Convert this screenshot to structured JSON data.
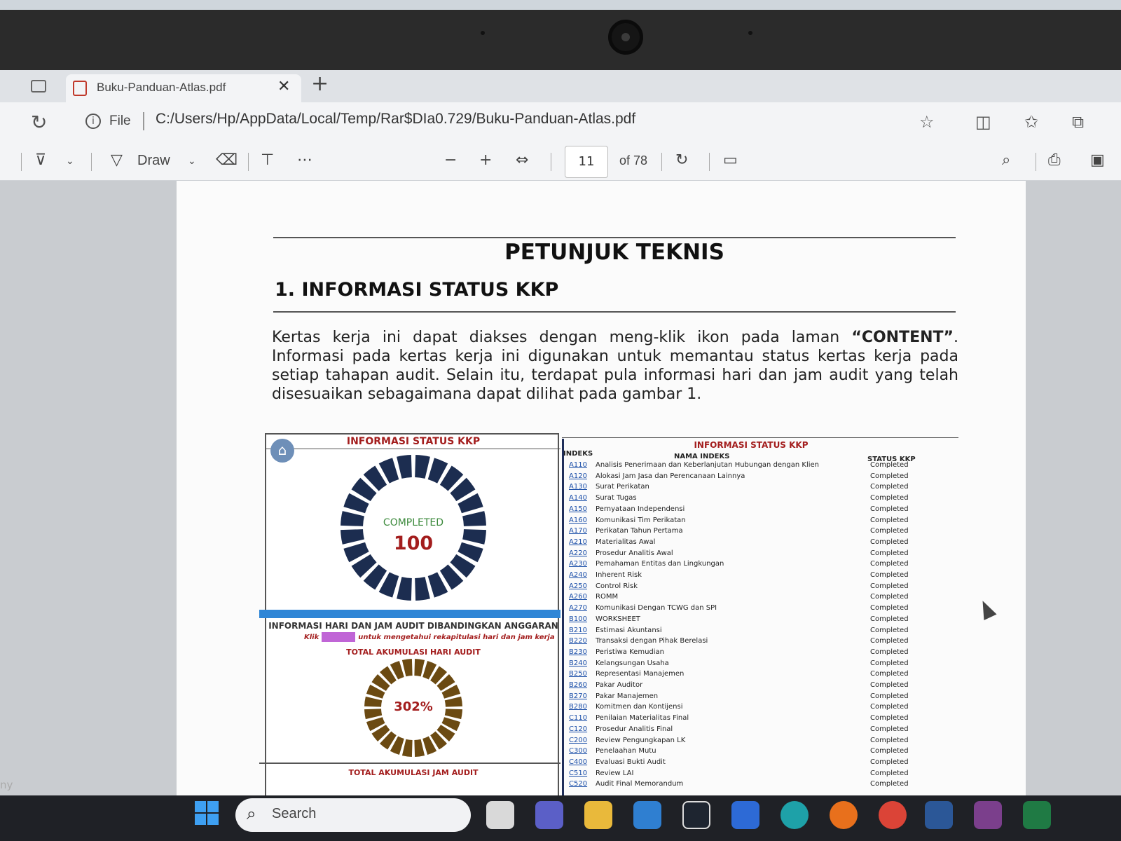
{
  "browser": {
    "tab_title": "Buku-Panduan-Atlas.pdf",
    "address_prefix": "File",
    "url": "C:/Users/Hp/AppData/Local/Temp/Rar$DIa0.729/Buku-Panduan-Atlas.pdf"
  },
  "toolbar": {
    "draw_label": "Draw",
    "current_page": "11",
    "total_pages_label": "of 78"
  },
  "document": {
    "title": "PETUNJUK TEKNIS",
    "heading": "1. INFORMASI STATUS KKP",
    "paragraph_before": "Kertas kerja ini dapat diakses dengan meng-klik ikon pada laman ",
    "paragraph_bold": "“CONTENT”",
    "paragraph_after": ". Informasi pada kertas kerja ini digunakan untuk memantau status kertas kerja pada setiap tahapan audit. Selain itu, terdapat pula informasi hari dan jam audit yang telah disesuaikan sebagaimana dapat dilihat pada gambar 1."
  },
  "figure": {
    "left_title": "INFORMASI STATUS KKP",
    "completed_label": "COMPLETED",
    "completed_value": "100",
    "completed_percent": 100,
    "audit_info_title": "INFORMASI HARI DAN JAM AUDIT DIBANDINGKAN ANGGARAN",
    "klik_label": "Klik",
    "klik_text": "untuk mengetahui rekapitulasi hari dan jam kerja",
    "total_hari_label": "TOTAL AKUMULASI HARI AUDIT",
    "total_hari_value": "302%",
    "total_jam_label": "TOTAL AKUMULASI JAM AUDIT",
    "right_title": "INFORMASI STATUS KKP",
    "col_indeks": "INDEKS",
    "col_nama": "NAMA INDEKS",
    "col_status": "STATUS KKP",
    "rows": [
      {
        "code": "A110",
        "name": "Analisis Penerimaan dan Keberlanjutan Hubungan dengan Klien",
        "status": "Completed"
      },
      {
        "code": "A120",
        "name": "Alokasi Jam Jasa dan Perencanaan Lainnya",
        "status": "Completed"
      },
      {
        "code": "A130",
        "name": "Surat Perikatan",
        "status": "Completed"
      },
      {
        "code": "A140",
        "name": "Surat Tugas",
        "status": "Completed"
      },
      {
        "code": "A150",
        "name": "Pernyataan Independensi",
        "status": "Completed"
      },
      {
        "code": "A160",
        "name": "Komunikasi Tim Perikatan",
        "status": "Completed"
      },
      {
        "code": "A170",
        "name": "Perikatan Tahun Pertama",
        "status": "Completed"
      },
      {
        "code": "A210",
        "name": "Materialitas Awal",
        "status": "Completed"
      },
      {
        "code": "A220",
        "name": "Prosedur Analitis Awal",
        "status": "Completed"
      },
      {
        "code": "A230",
        "name": "Pemahaman Entitas dan Lingkungan",
        "status": "Completed"
      },
      {
        "code": "A240",
        "name": "Inherent Risk",
        "status": "Completed"
      },
      {
        "code": "A250",
        "name": "Control Risk",
        "status": "Completed"
      },
      {
        "code": "A260",
        "name": "ROMM",
        "status": "Completed"
      },
      {
        "code": "A270",
        "name": "Komunikasi Dengan TCWG dan SPI",
        "status": "Completed"
      },
      {
        "code": "B100",
        "name": "WORKSHEET",
        "status": "Completed"
      },
      {
        "code": "B210",
        "name": "Estimasi Akuntansi",
        "status": "Completed"
      },
      {
        "code": "B220",
        "name": "Transaksi dengan Pihak Berelasi",
        "status": "Completed"
      },
      {
        "code": "B230",
        "name": "Peristiwa Kemudian",
        "status": "Completed"
      },
      {
        "code": "B240",
        "name": "Kelangsungan Usaha",
        "status": "Completed"
      },
      {
        "code": "B250",
        "name": "Representasi Manajemen",
        "status": "Completed"
      },
      {
        "code": "B260",
        "name": "Pakar Auditor",
        "status": "Completed"
      },
      {
        "code": "B270",
        "name": "Pakar Manajemen",
        "status": "Completed"
      },
      {
        "code": "B280",
        "name": "Komitmen dan Kontijensi",
        "status": "Completed"
      },
      {
        "code": "C110",
        "name": "Penilaian Materialitas Final",
        "status": "Completed"
      },
      {
        "code": "C120",
        "name": "Prosedur Analitis Final",
        "status": "Completed"
      },
      {
        "code": "C200",
        "name": "Review Pengungkapan LK",
        "status": "Completed"
      },
      {
        "code": "C300",
        "name": "Penelaahan Mutu",
        "status": "Completed"
      },
      {
        "code": "C400",
        "name": "Evaluasi Bukti Audit",
        "status": "Completed"
      },
      {
        "code": "C510",
        "name": "Review LAI",
        "status": "Completed"
      },
      {
        "code": "C520",
        "name": "Audit Final Memorandum",
        "status": "Completed"
      }
    ]
  },
  "taskbar": {
    "side_text": "ny",
    "search_placeholder": "Search"
  },
  "colors": {
    "donut_navy": "#1c2d50",
    "donut_brown": "#6b4a12",
    "accent_red": "#a31d1d",
    "accent_blue": "#2f86d6"
  }
}
